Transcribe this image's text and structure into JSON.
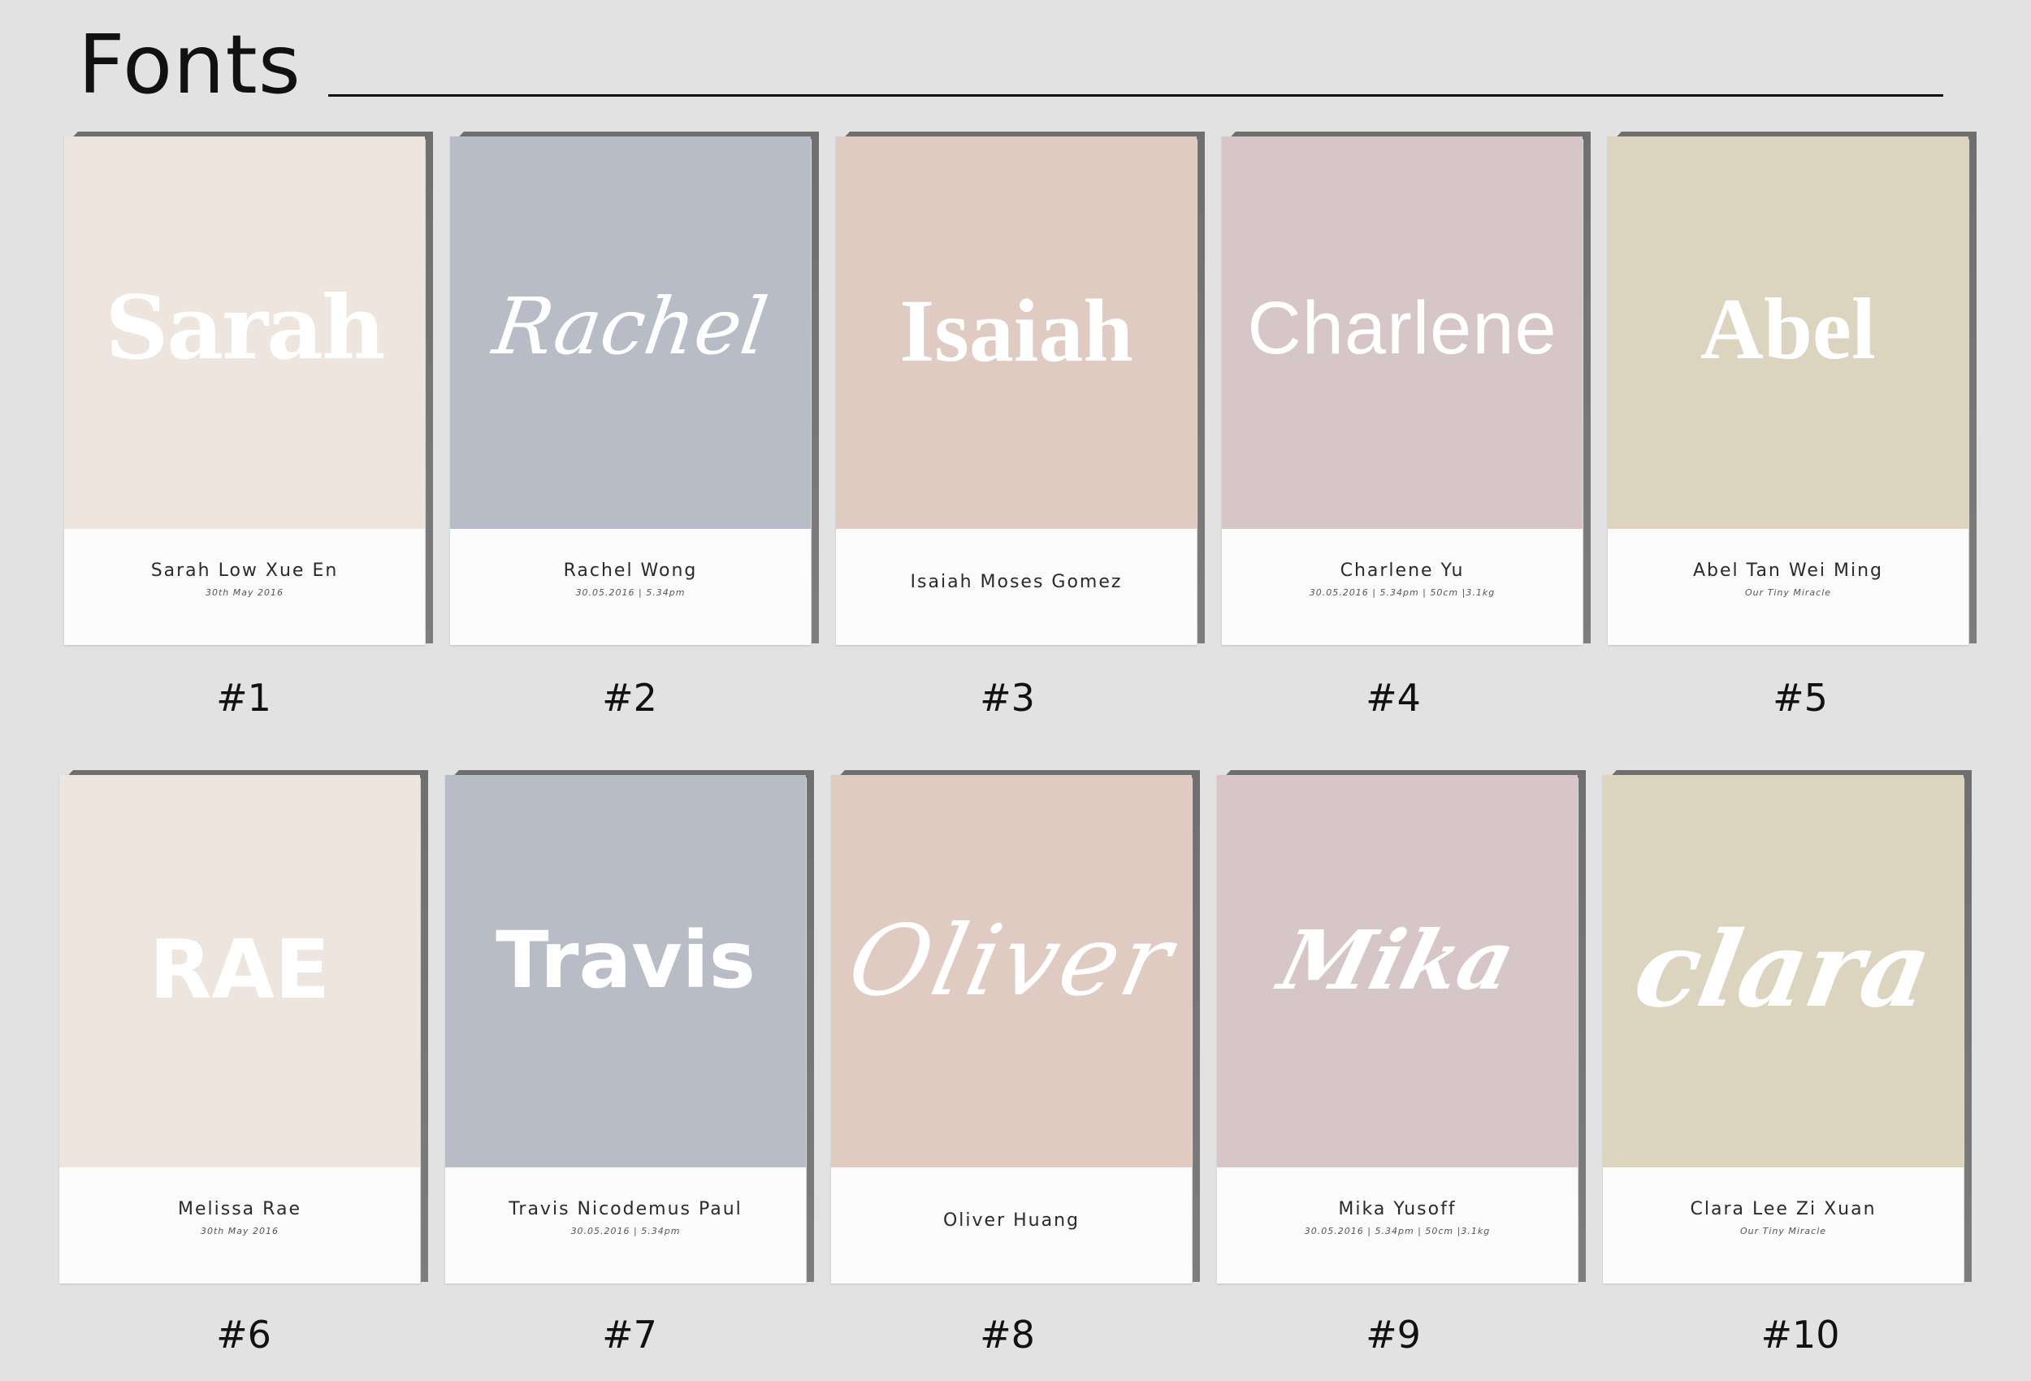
{
  "header": {
    "title": "Fonts"
  },
  "cards": [
    {
      "name": "Sarah",
      "full_name": "Sarah Low Xue En",
      "sub": "30th May 2016",
      "number": "#1",
      "color": "#ede5de"
    },
    {
      "name": "Rachel",
      "full_name": "Rachel Wong",
      "sub": "30.05.2016  |  5.34pm",
      "number": "#2",
      "color": "#b8bcc6"
    },
    {
      "name": "Isaiah",
      "full_name": "Isaiah Moses Gomez",
      "sub": "",
      "number": "#3",
      "color": "#dfcbc1"
    },
    {
      "name": "Charlene",
      "full_name": "Charlene Yu",
      "sub": "30.05.2016  |  5.34pm  |  50cm  |3.1kg",
      "number": "#4",
      "color": "#d7c6c8"
    },
    {
      "name": "Abel",
      "full_name": "Abel Tan Wei Ming",
      "sub": "Our Tiny Miracle",
      "number": "#5",
      "color": "#dcd4bf"
    },
    {
      "name": "RAE",
      "full_name": "Melissa Rae",
      "sub": "30th May 2016",
      "number": "#6",
      "color": "#ede5de"
    },
    {
      "name": "Travis",
      "full_name": "Travis Nicodemus Paul",
      "sub": "30.05.2016  |  5.34pm",
      "number": "#7",
      "color": "#b8bcc6"
    },
    {
      "name": "Oliver",
      "full_name": "Oliver Huang",
      "sub": "",
      "number": "#8",
      "color": "#dfcbc1"
    },
    {
      "name": "Mika",
      "full_name": "Mika Yusoff",
      "sub": "30.05.2016  |  5.34pm  |  50cm  |3.1kg",
      "number": "#9",
      "color": "#d7c6c8"
    },
    {
      "name": "clara",
      "full_name": "Clara Lee Zi Xuan",
      "sub": "Our Tiny Miracle",
      "number": "#10",
      "color": "#dcd4bf"
    }
  ]
}
